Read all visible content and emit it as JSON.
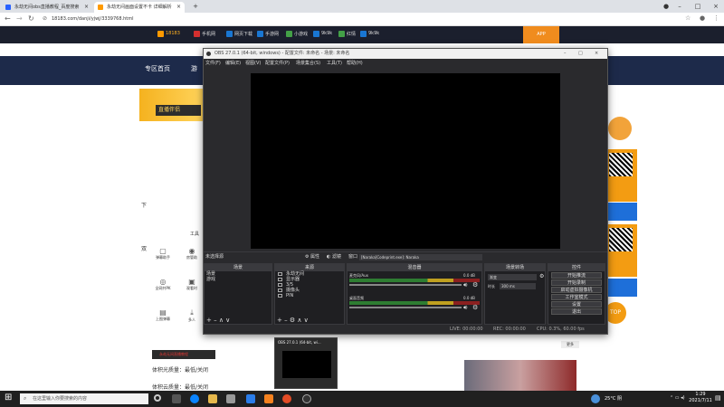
{
  "tabs": [
    {
      "title": "永劫无间obs直播教程_百度搜索"
    },
    {
      "title": "永劫无间画面设置不卡 详细解析"
    }
  ],
  "address": {
    "url": "18183.com/danji/yjwj/3339768.html"
  },
  "bookmarks": [
    {
      "label": "18183",
      "color": "#ff9a00"
    },
    {
      "label": "手机网",
      "color": "#d32f2f"
    },
    {
      "label": "网页下载",
      "color": "#1976d2"
    },
    {
      "label": "手游网",
      "color": "#1976d2"
    },
    {
      "label": "小游戏",
      "color": "#43a047"
    },
    {
      "label": "9k9k",
      "color": "#1976d2"
    },
    {
      "label": "红情",
      "color": "#43a047"
    },
    {
      "label": "9k9k",
      "color": "#1976d2"
    }
  ],
  "site": {
    "nav_home": "专区首页",
    "nav_2": "游",
    "left_text_1": "下",
    "left_text_2": "双",
    "tools_label": "工具",
    "hover_btn": "返回顶部",
    "left_icons": [
      {
        "label": "弹幕助手"
      },
      {
        "label": "房管助"
      },
      {
        "label": "全网共PK"
      },
      {
        "label": "观看时"
      },
      {
        "label": "上图弹幕"
      },
      {
        "label": "多人"
      }
    ],
    "body_line_1": "体积光质量：最低/关闭",
    "body_line_2": "体积云质量：最低/关闭",
    "red_line": "永劫无间直播教程",
    "more_label": "更多",
    "top_badge": "TOP"
  },
  "obs": {
    "title": "OBS 27.0.1 (64-bit, windows) - 配置文件: 未命名 - 场景: 未命名",
    "menu": [
      "文件(F)",
      "编辑(E)",
      "视图(V)",
      "配置文件(P)",
      "场景集合(S)",
      "工具(T)",
      "帮助(H)"
    ],
    "no_source": "未选择源",
    "properties_btn": "属性",
    "filters_btn": "滤镜",
    "window_label": "窗口",
    "window_value": "[Naraka]Codeprint.exe]: Naraka",
    "scenes": {
      "title": "场景",
      "items": [
        "场景",
        "游戏"
      ]
    },
    "sources": {
      "title": "来源",
      "items": [
        "永劫无间",
        "显示器",
        "3/5",
        "摄像头",
        "PIN"
      ]
    },
    "mixer": {
      "title": "混音器",
      "ch1_name": "麦克风/Aux",
      "ch1_db": "0.0 dB",
      "ch2_name": "桌面音频",
      "ch2_db": "0.0 dB"
    },
    "transitions": {
      "title": "场景转场",
      "type": "渐变",
      "duration_label": "时长",
      "duration": "300 ms"
    },
    "controls": {
      "title": "控件",
      "buttons": [
        "开始推流",
        "开始录制",
        "启动虚拟摄像机",
        "工作室模式",
        "设置",
        "退出"
      ]
    },
    "status": {
      "live": "LIVE: 00:00:00",
      "rec": "REC: 00:00:00",
      "cpu": "CPU: 0.3%, 60.00 fps"
    }
  },
  "taskbar": {
    "search_placeholder": "在这里输入你要搜索的内容",
    "weather": "25°C 阴",
    "time": "1:29",
    "date": "2021/7/11",
    "preview_title": "OBS 27.0.1 (64-bit, wi..."
  }
}
